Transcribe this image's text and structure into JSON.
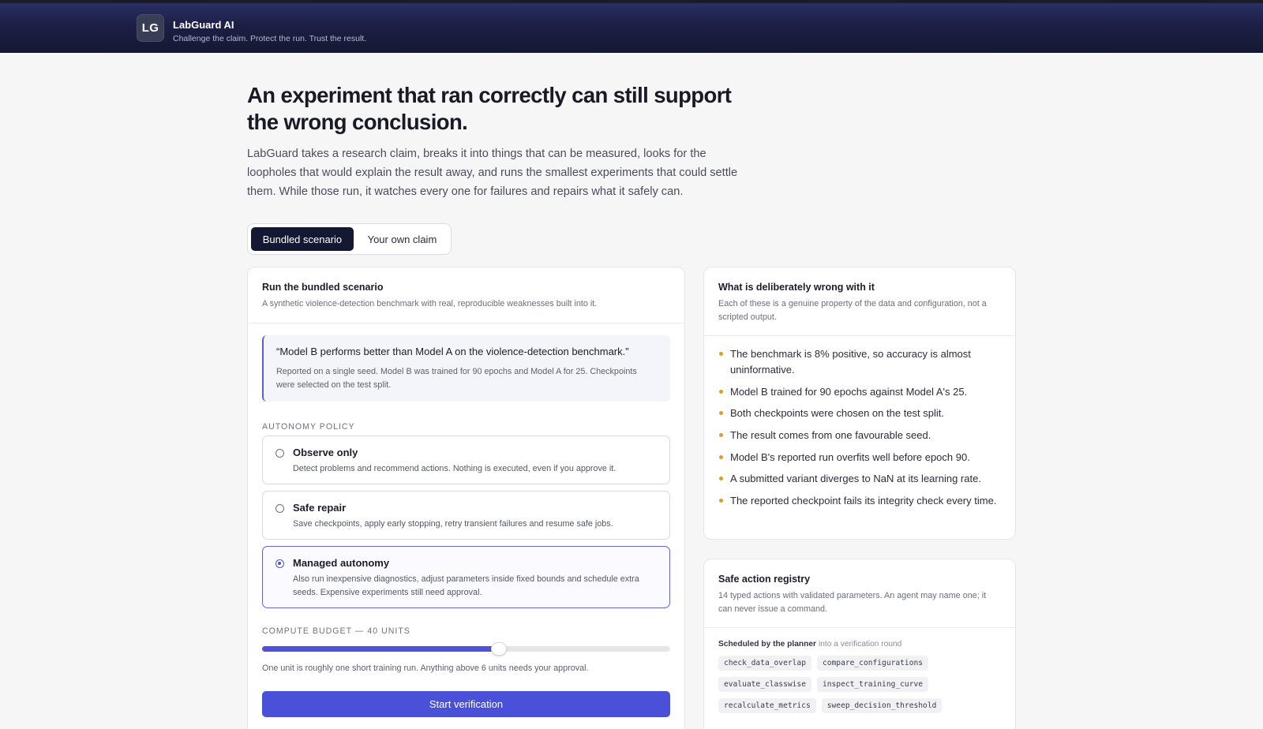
{
  "app": {
    "logo_text": "LG",
    "name": "LabGuard AI",
    "tagline": "Challenge the claim. Protect the run. Trust the result."
  },
  "hero": {
    "title": "An experiment that ran correctly can still support the wrong conclusion.",
    "description": "LabGuard takes a research claim, breaks it into things that can be measured, looks for the loopholes that would explain the result away, and runs the smallest experiments that could settle them. While those run, it watches every one for failures and repairs what it safely can."
  },
  "tabs": [
    {
      "label": "Bundled scenario",
      "active": true
    },
    {
      "label": "Your own claim",
      "active": false
    }
  ],
  "scenario": {
    "title": "Run the bundled scenario",
    "subtitle": "A synthetic violence-detection benchmark with real, reproducible weaknesses built into it.",
    "claim": "“Model B performs better than Model A on the violence-detection benchmark.”",
    "claim_note": "Reported on a single seed. Model B was trained for 90 epochs and Model A for 25. Checkpoints were selected on the test split.",
    "policy_label": "AUTONOMY POLICY",
    "policies": [
      {
        "title": "Observe only",
        "desc": "Detect problems and recommend actions. Nothing is executed, even if you approve it.",
        "selected": false
      },
      {
        "title": "Safe repair",
        "desc": "Save checkpoints, apply early stopping, retry transient failures and resume safe jobs.",
        "selected": false
      },
      {
        "title": "Managed autonomy",
        "desc": "Also run inexpensive diagnostics, adjust parameters inside fixed bounds and schedule extra seeds. Expensive experiments still need approval.",
        "selected": true
      }
    ],
    "budget_label": "COMPUTE BUDGET — 40 UNITS",
    "budget_level": 0.58,
    "budget_note": "One unit is roughly one short training run. Anything above 6 units needs your approval.",
    "start_label": "Start verification"
  },
  "flaws": {
    "title": "What is deliberately wrong with it",
    "subtitle": "Each of these is a genuine property of the data and configuration, not a scripted output.",
    "items": [
      "The benchmark is 8% positive, so accuracy is almost uninformative.",
      "Model B trained for 90 epochs against Model A's 25.",
      "Both checkpoints were chosen on the test split.",
      "The result comes from one favourable seed.",
      "Model B's reported run overfits well before epoch 90.",
      "A submitted variant diverges to NaN at its learning rate.",
      "The reported checkpoint fails its integrity check every time."
    ],
    "bullet_color": "#e49b1d"
  },
  "registry": {
    "title": "Safe action registry",
    "subtitle": "14 typed actions with validated parameters. An agent may name one; it can never issue a command.",
    "scheduled_bold": "Scheduled by the planner",
    "scheduled_muted": "into a verification round",
    "chips": [
      "check_data_overlap",
      "compare_configurations",
      "evaluate_classwise",
      "inspect_training_curve",
      "recalculate_metrics",
      "sweep_decision_threshold"
    ]
  },
  "colors": {
    "accent": "#4a50d8",
    "header_dark": "#151832"
  }
}
